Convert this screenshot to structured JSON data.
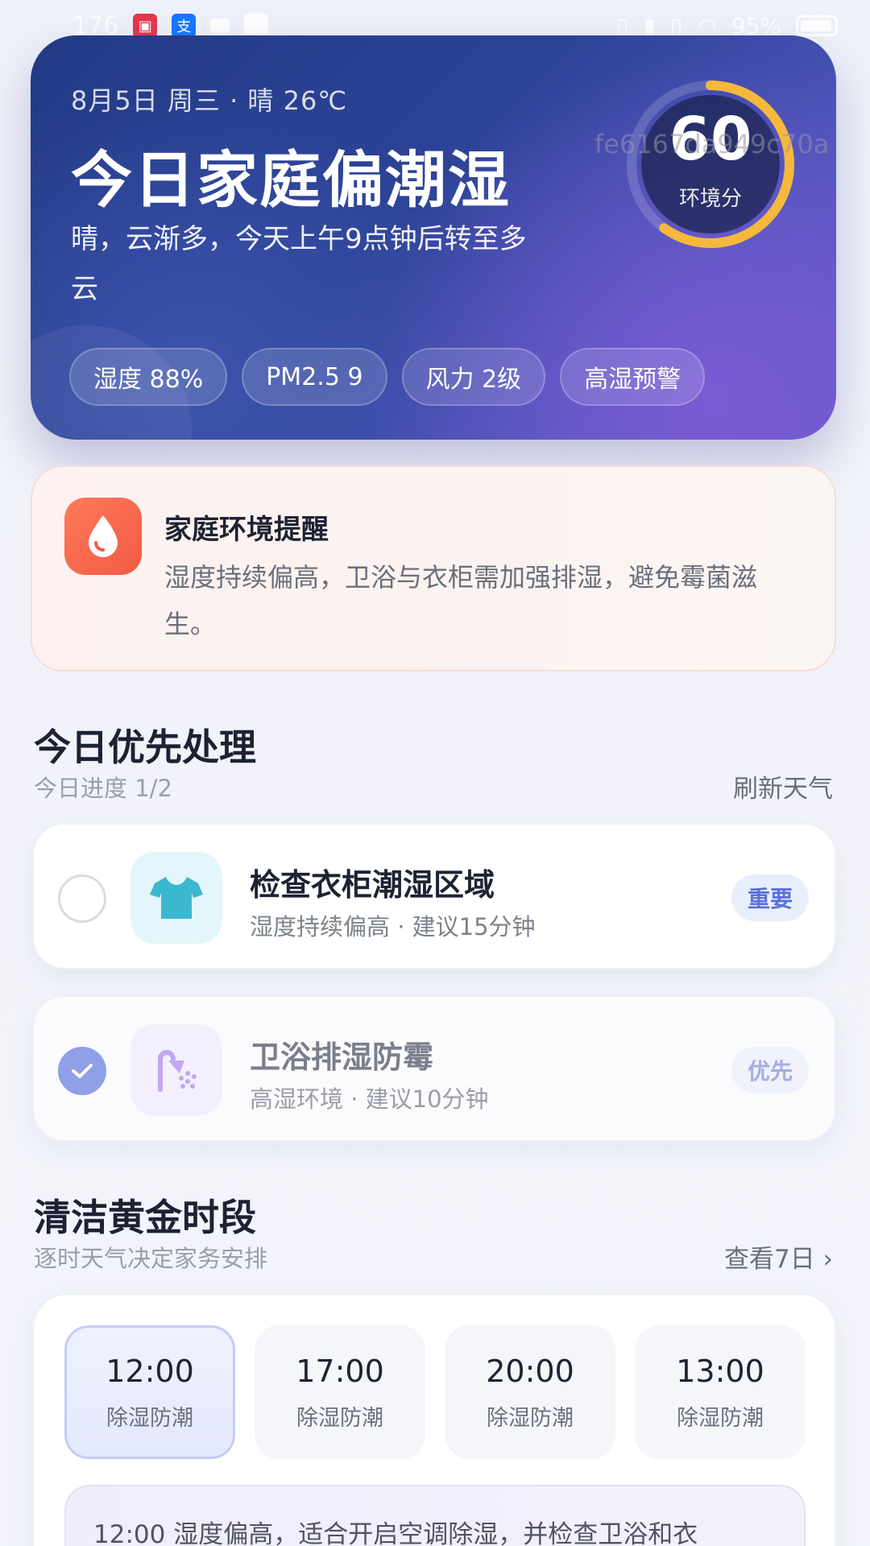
{
  "status_bar": {
    "time": "176",
    "battery": "95%"
  },
  "hero": {
    "date": "8月5日 周三 · 晴 26℃",
    "title": "今日家庭偏潮湿",
    "description": "晴，云渐多，今天上午9点钟后转至多云",
    "chips": [
      "湿度 88%",
      "PM2.5 9",
      "风力 2级",
      "高湿预警"
    ],
    "score": "60",
    "score_label": "环境分",
    "score_fraction": 0.6,
    "watermark": "fe6167da949c70a"
  },
  "reminder": {
    "title": "家庭环境提醒",
    "text": "湿度持续偏高，卫浴与衣柜需加强排湿，避免霉菌滋生。",
    "icon": "water-drop-icon"
  },
  "priority": {
    "title": "今日优先处理",
    "progress": "今日进度 1/2",
    "refresh": "刷新天气",
    "tasks": [
      {
        "title": "检查衣柜潮湿区域",
        "meta": "湿度持续偏高 · 建议15分钟",
        "tag": "重要",
        "done": false,
        "icon": "tshirt-icon"
      },
      {
        "title": "卫浴排湿防霉",
        "meta": "高湿环境 · 建议10分钟",
        "tag": "优先",
        "done": true,
        "icon": "shower-icon"
      }
    ]
  },
  "golden": {
    "title": "清洁黄金时段",
    "subtitle": "逐时天气决定家务安排",
    "link": "查看7日 ›",
    "slots": [
      {
        "time": "12:00",
        "label": "除湿防潮"
      },
      {
        "time": "17:00",
        "label": "除湿防潮"
      },
      {
        "time": "20:00",
        "label": "除湿防潮"
      },
      {
        "time": "13:00",
        "label": "除湿防潮"
      }
    ],
    "advice": "12:00 湿度偏高，适合开启空调除湿，并检查卫浴和衣"
  },
  "colors": {
    "accent": "#8f9fe8",
    "gauge_ring": "#f5b83d",
    "alert": "#f25a43"
  }
}
